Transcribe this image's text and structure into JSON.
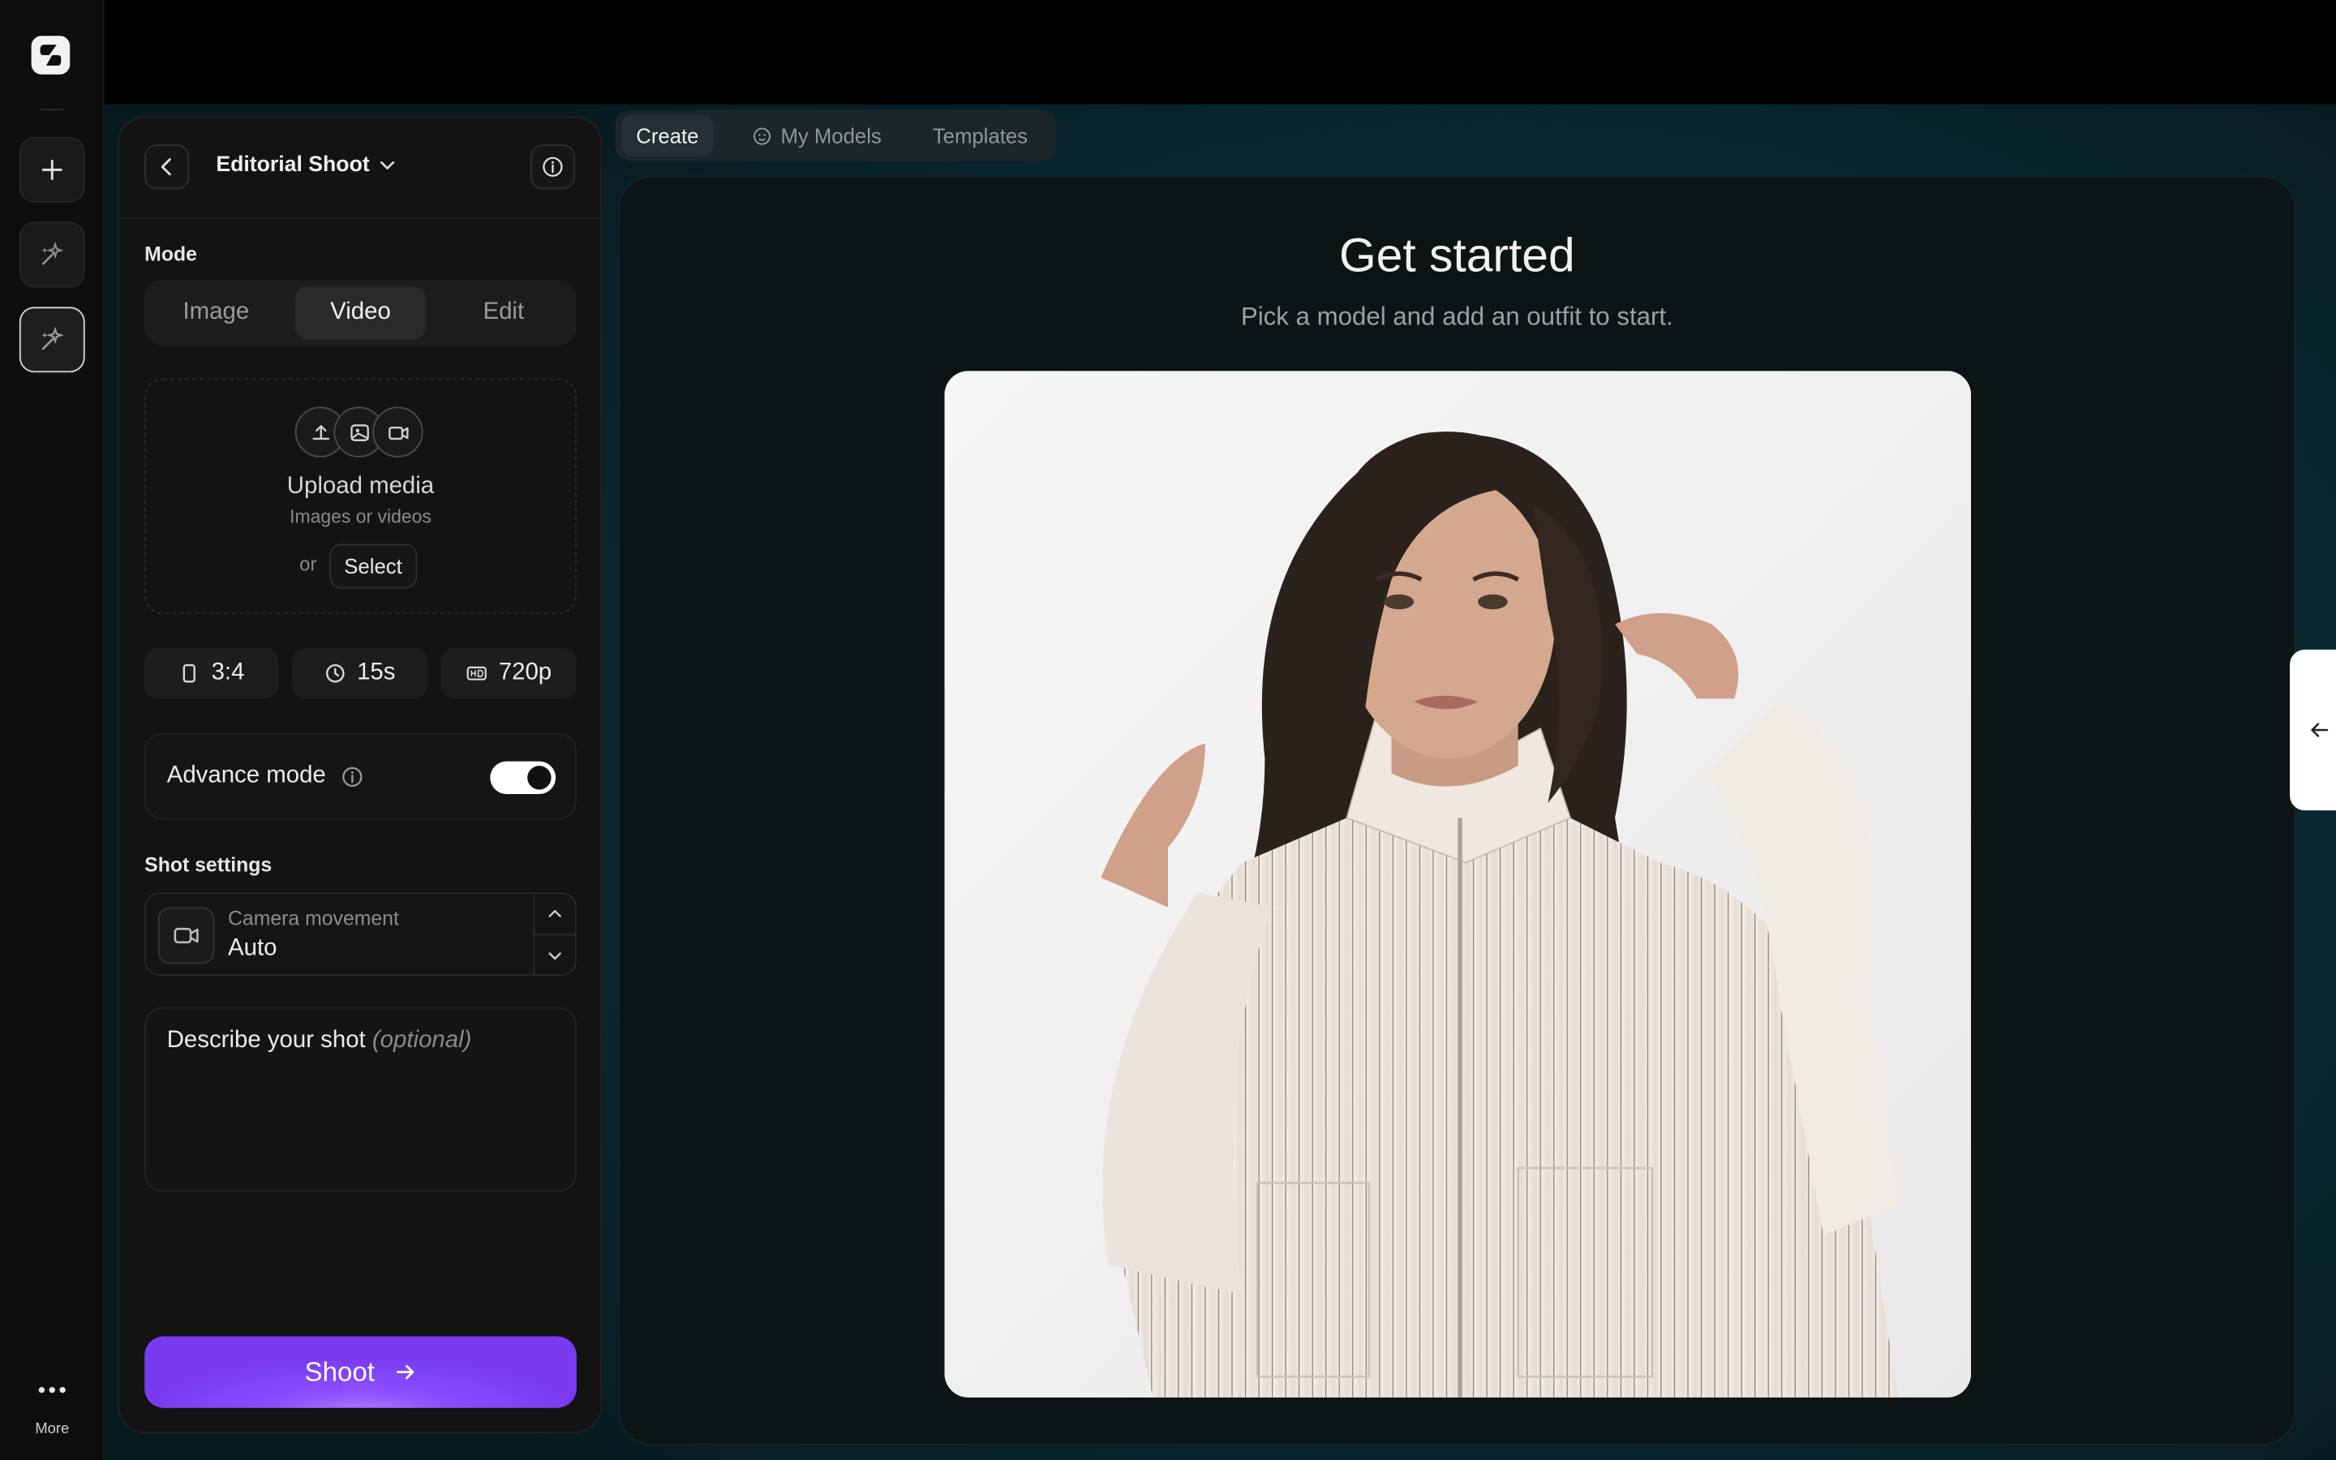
{
  "rail": {
    "items": [
      {
        "icon": "logo-icon"
      },
      {
        "icon": "plus-icon"
      },
      {
        "icon": "sparkle-wand-icon"
      },
      {
        "icon": "sparkle-wand-icon",
        "active": true
      }
    ],
    "more_label": "More"
  },
  "panel": {
    "title": "Editorial Shoot",
    "mode_label": "Mode",
    "modes": [
      "Image",
      "Video",
      "Edit"
    ],
    "selected_mode": "Video",
    "upload": {
      "title": "Upload media",
      "subtitle": "Images or videos",
      "or": "or",
      "select_label": "Select"
    },
    "chips": {
      "aspect": "3:4",
      "duration": "15s",
      "resolution": "720p"
    },
    "advance_mode": {
      "label": "Advance mode",
      "enabled": true
    },
    "shot_settings_label": "Shot settings",
    "camera": {
      "label": "Camera movement",
      "value": "Auto"
    },
    "describe": {
      "label": "Describe your shot",
      "optional": "(optional)"
    },
    "shoot_label": "Shoot"
  },
  "tabs": [
    {
      "label": "Create",
      "selected": true
    },
    {
      "label": "My Models",
      "icon": "face-icon"
    },
    {
      "label": "Templates"
    }
  ],
  "main": {
    "title": "Get started",
    "subtitle": "Pick a model and add an outfit to start."
  },
  "colors": {
    "accent": "#8a4dff",
    "background": "#0c1416",
    "panel": "#131313"
  }
}
